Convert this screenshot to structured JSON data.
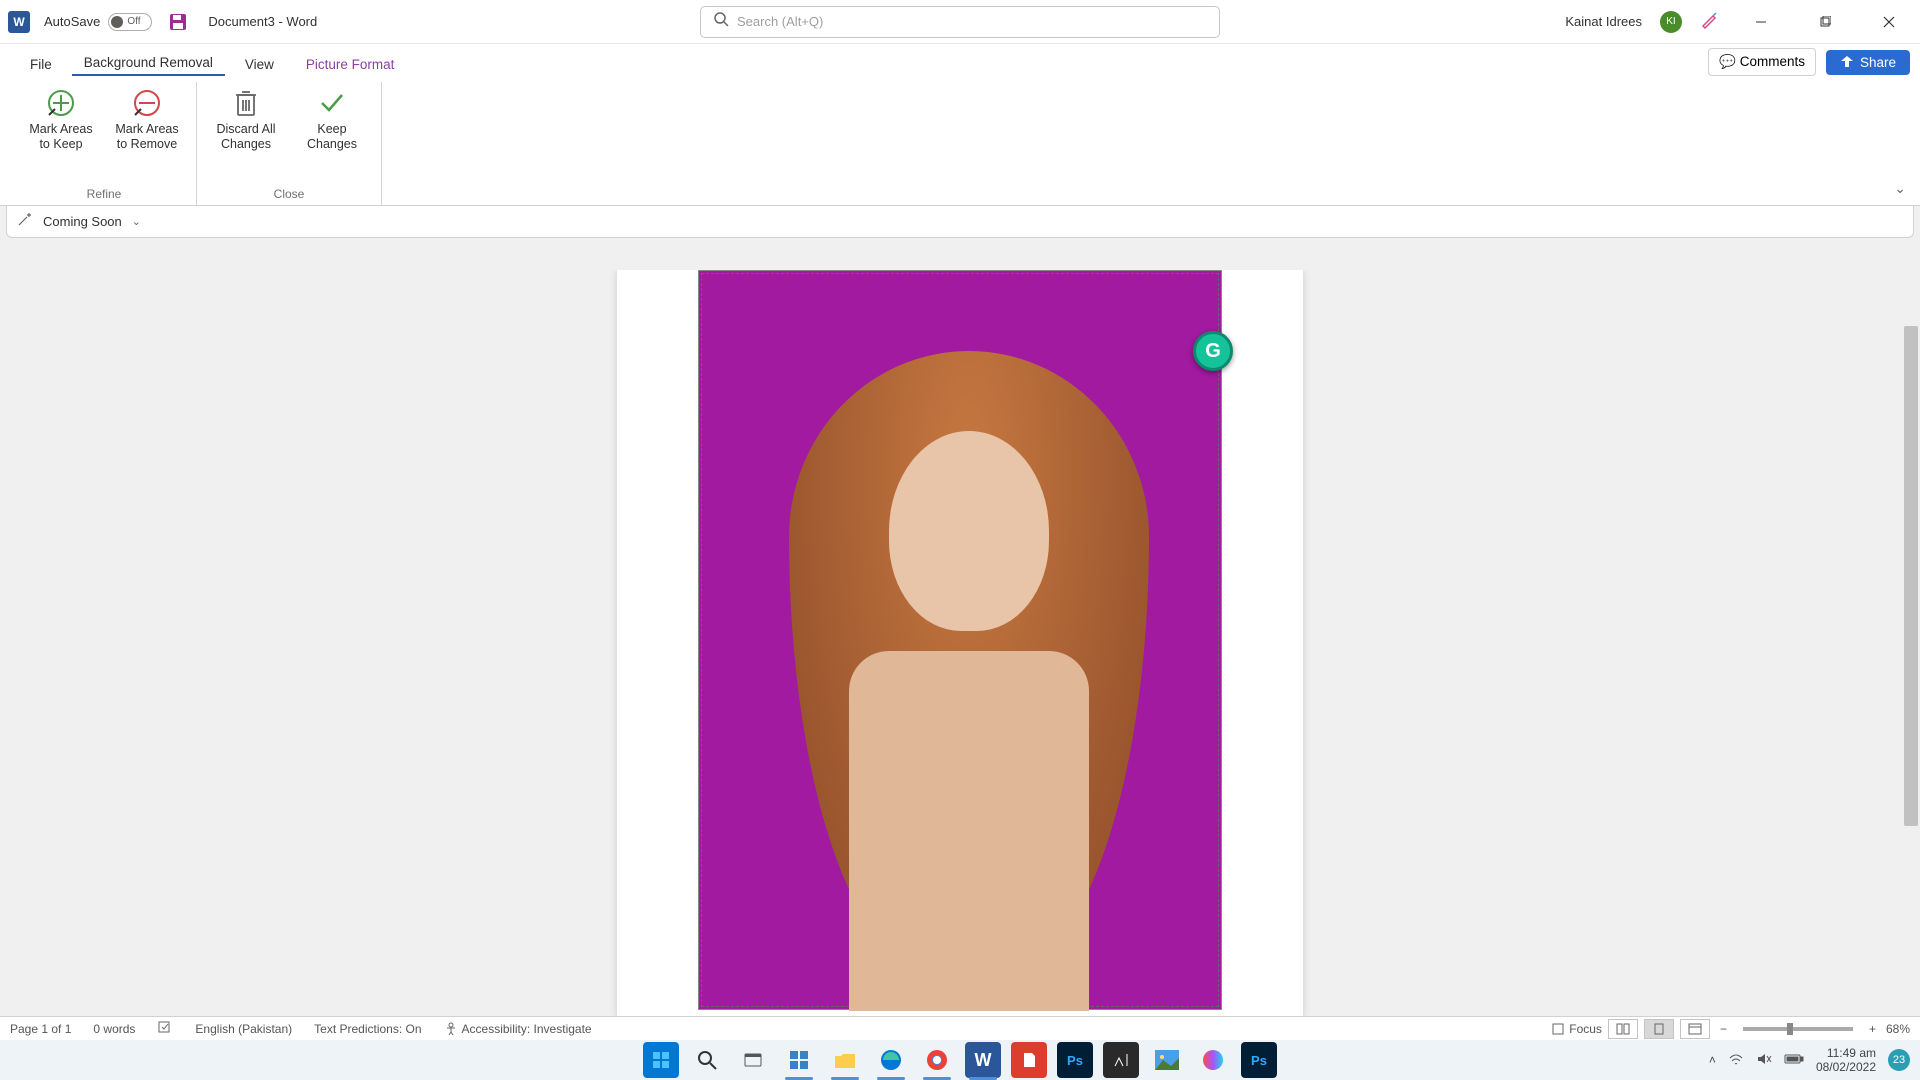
{
  "title_bar": {
    "autosave_label": "AutoSave",
    "autosave_state": "Off",
    "doc_title": "Document3  -  Word",
    "search_placeholder": "Search (Alt+Q)",
    "user_name": "Kainat Idrees",
    "user_initials": "KI"
  },
  "tabs": {
    "file": "File",
    "bg_removal": "Background Removal",
    "view": "View",
    "pic_format": "Picture Format"
  },
  "actions": {
    "comments": "Comments",
    "share": "Share"
  },
  "ribbon": {
    "mark_keep_l1": "Mark Areas",
    "mark_keep_l2": "to Keep",
    "mark_remove_l1": "Mark Areas",
    "mark_remove_l2": "to Remove",
    "discard_l1": "Discard All",
    "discard_l2": "Changes",
    "keep_l1": "Keep",
    "keep_l2": "Changes",
    "group_refine": "Refine",
    "group_close": "Close"
  },
  "quick_bar": {
    "label": "Coming Soon"
  },
  "grammarly_badge": "G",
  "status": {
    "page": "Page 1 of 1",
    "words": "0 words",
    "language": "English (Pakistan)",
    "predictions": "Text Predictions: On",
    "accessibility": "Accessibility: Investigate",
    "focus": "Focus",
    "zoom": "68%"
  },
  "system_tray": {
    "time": "11:49 am",
    "date": "08/02/2022",
    "notif_count": "23"
  }
}
